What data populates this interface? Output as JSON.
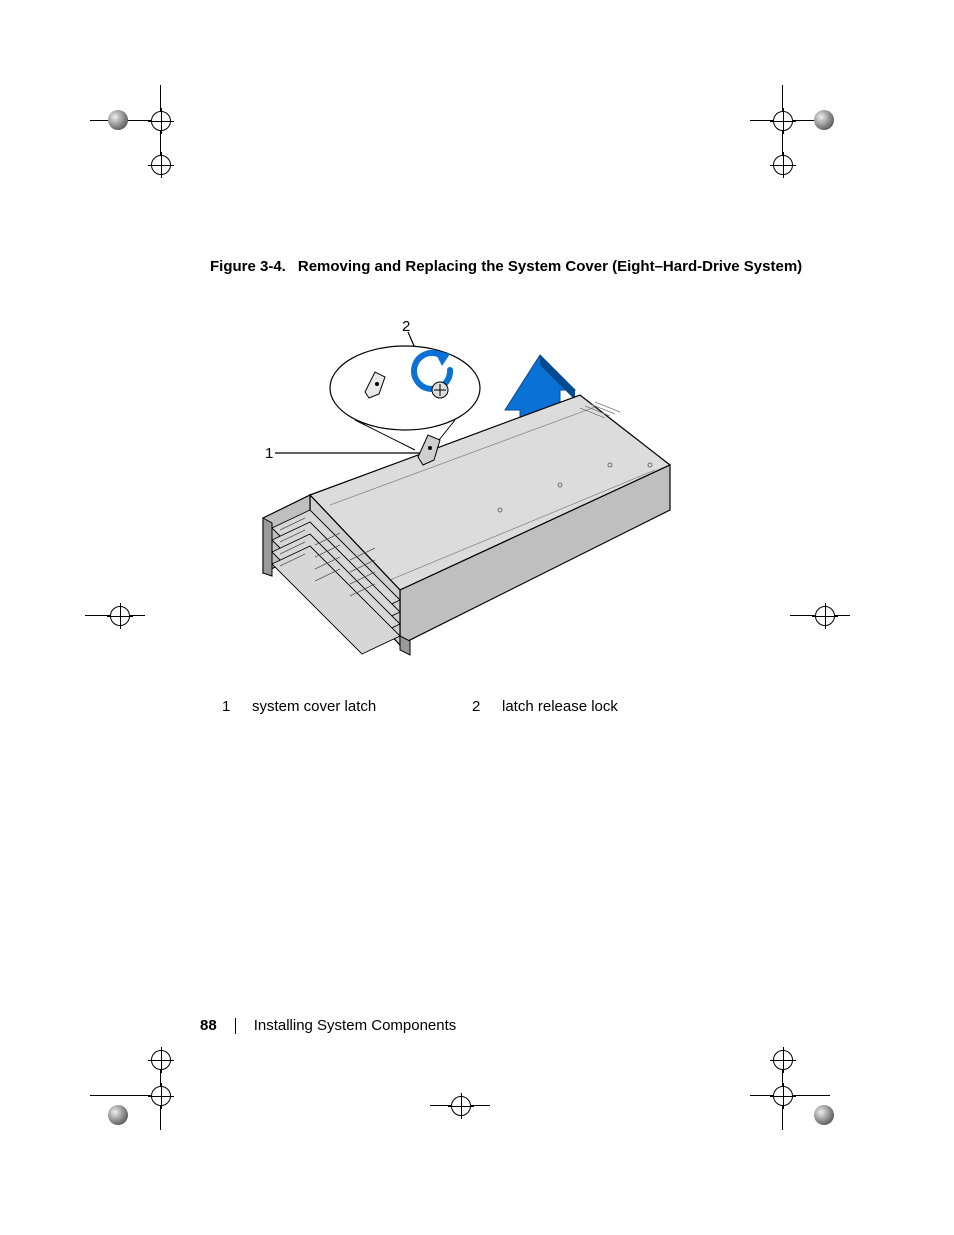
{
  "figure": {
    "number": "Figure 3-4.",
    "title": "Removing and Replacing the System Cover (Eight–Hard-Drive System)"
  },
  "callouts": {
    "one": "1",
    "two": "2"
  },
  "legend": [
    {
      "num": "1",
      "label": "system cover latch"
    },
    {
      "num": "2",
      "label": "latch release lock"
    }
  ],
  "footer": {
    "page": "88",
    "section": "Installing System Components"
  }
}
